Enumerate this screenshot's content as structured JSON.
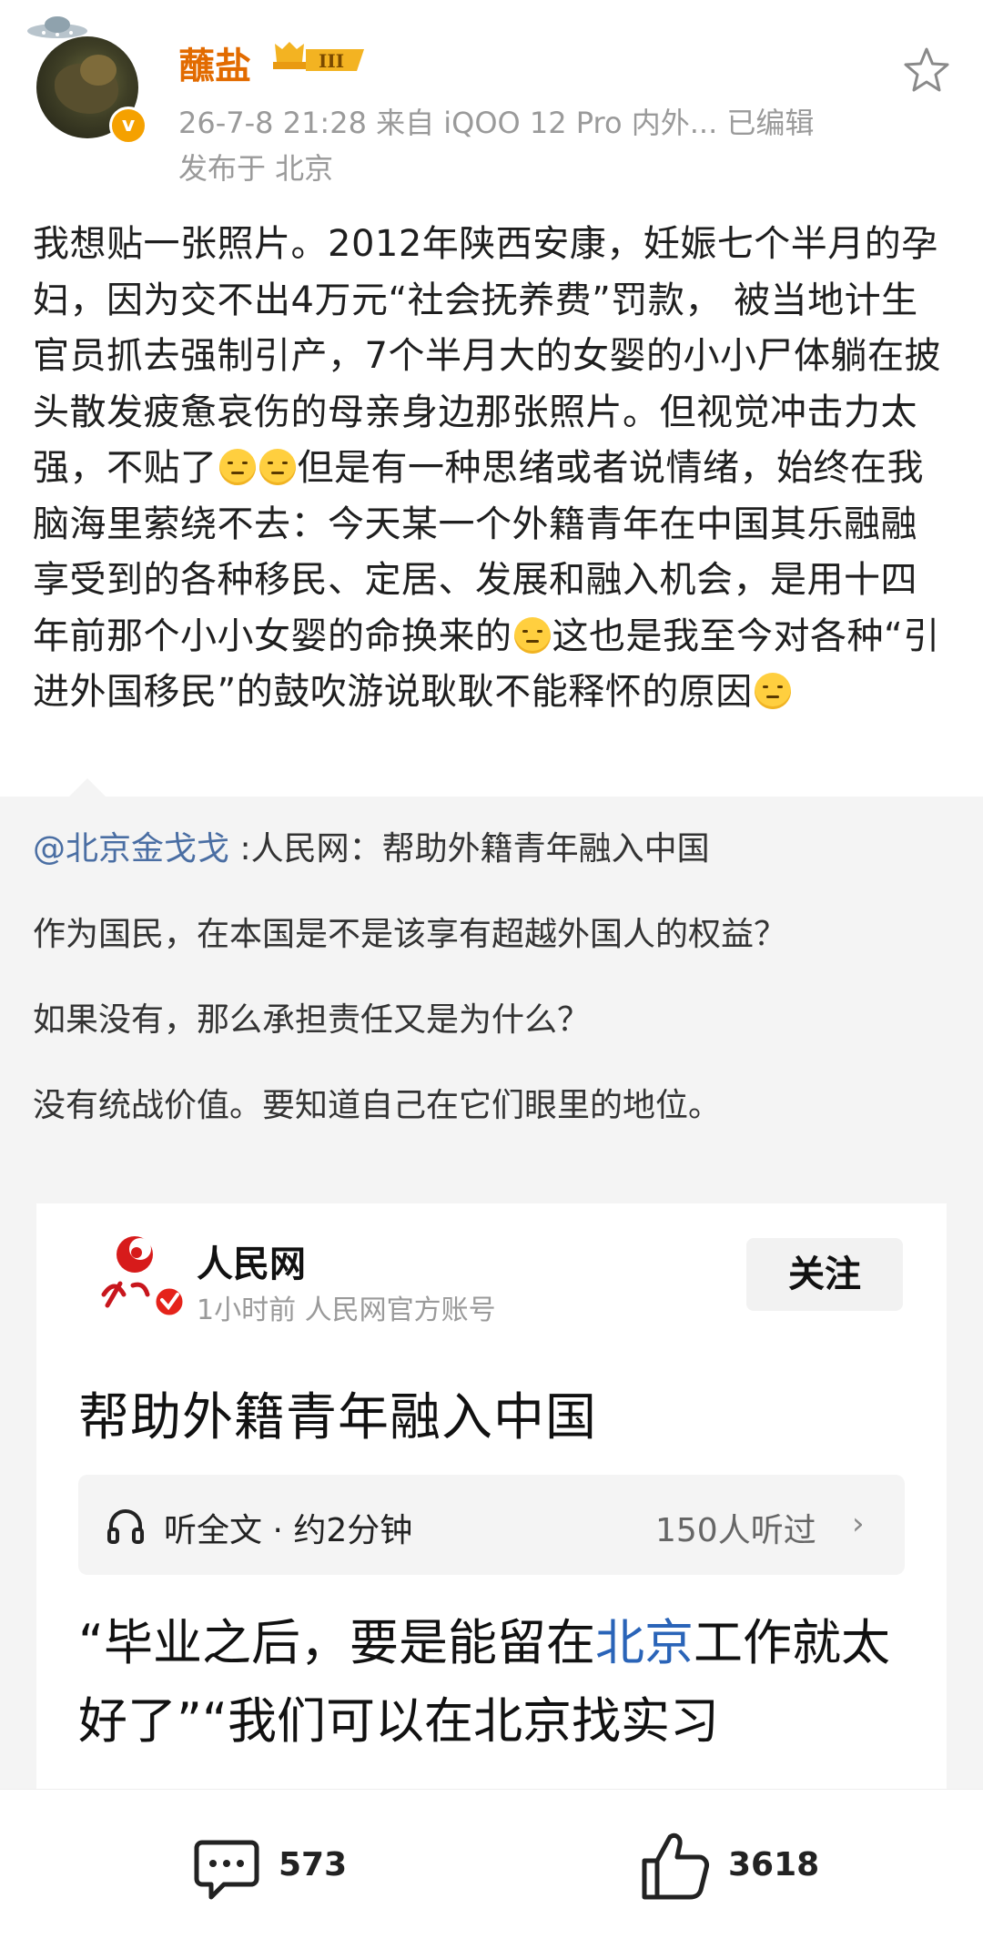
{
  "post": {
    "username": "蘸盐",
    "level_badge": "III",
    "meta": "26-7-8 21:28   来自 iQOO 12 Pro 内外...   已编辑",
    "location": "发布于 北京",
    "text_parts": [
      "我想贴一张照片。2012年陕西安康，妊娠七个半月的孕妇，因为交不出4万元“社会抚养费”罚款， 被当地计生官员抓去强制引产，7个半月大的女婴的小小尸体躺在披头散发疲惫哀伤的母亲身边那张照片。但视觉冲击力太强，不贴了",
      "但是有一种思绪或者说情绪，始终在我脑海里萦绕不去：今天某一个外籍青年在中国其乐融融享受到的各种移民、定居、发展和融入机会，是用十四年前那个小小女婴的命换来的",
      "这也是我至今对各种“引进外国移民”的鼓吹游说耿耿不能释怀的原因"
    ]
  },
  "repost": {
    "mention": "@北京金戈戈",
    "title_line": " :人民网：帮助外籍青年融入中国",
    "para1": "作为国民，在本国是不是该享有超越外国人的权益？",
    "para2": "如果没有，那么承担责任又是为什么？",
    "para3": "没有统战价值。要知道自己在它们眼里的地位。"
  },
  "card": {
    "source_name": "人民网",
    "source_sub": "1小时前  人民网官方账号",
    "follow_label": "关注",
    "article_title": "帮助外籍青年融入中国",
    "listen_label": "听全文 · 约2分钟",
    "listen_count": "150人听过",
    "quote_a": "“毕业之后，要是能留在",
    "quote_hl": "北京",
    "quote_b": "工作就太好了”“我们可以在北京找实习"
  },
  "actions": {
    "comments": "573",
    "likes": "3618"
  },
  "icons": [
    "ufo-icon",
    "verified-icon",
    "star-icon",
    "headphones-icon",
    "comment-icon",
    "like-icon"
  ],
  "colors": {
    "username": "#e26b00",
    "mention": "#4a6ea3",
    "highlight": "#2a64b8",
    "badge": "#f5a100"
  }
}
